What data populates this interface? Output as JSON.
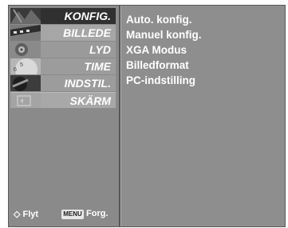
{
  "menu": {
    "items": [
      {
        "label": "KONFIG.",
        "icon": "setup-thumbnail-icon"
      },
      {
        "label": "BILLEDE",
        "icon": "picture-thumbnail-icon"
      },
      {
        "label": "LYD",
        "icon": "audio-thumbnail-icon"
      },
      {
        "label": "TIME",
        "icon": "clock-thumbnail-icon"
      },
      {
        "label": "INDSTIL.",
        "icon": "option-thumbnail-icon"
      },
      {
        "label": "SKÄRM",
        "icon": "screen-thumbnail-icon"
      }
    ],
    "selected_index": 5
  },
  "submenu": {
    "options": [
      "Auto. konfig.",
      "Manuel konfig.",
      "XGA Modus",
      "Billedformat",
      "PC-indstilling"
    ]
  },
  "footer": {
    "move_symbol": "◇",
    "move_label": "Flyt",
    "menu_badge": "MENU",
    "back_label": "Forg."
  },
  "colors": {
    "panel_bg": "#8d8d8d",
    "selected_bg": "#303030",
    "text": "#ffffff"
  }
}
